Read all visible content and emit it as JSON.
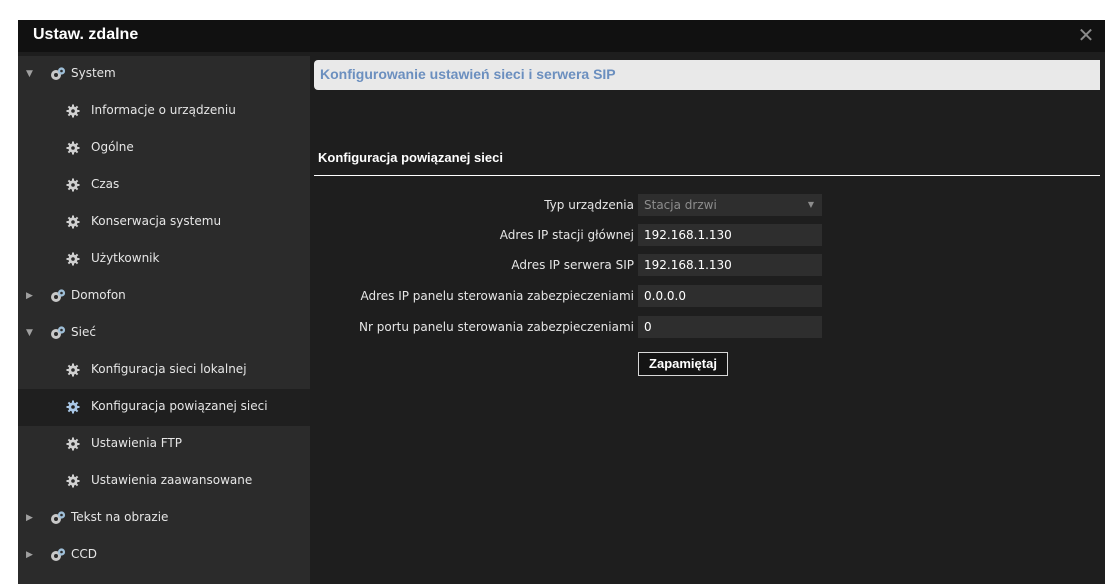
{
  "window": {
    "title": "Ustaw. zdalne",
    "close_glyph": "✕"
  },
  "sidebar": {
    "items": [
      {
        "label": "System",
        "level": "top",
        "expanded": true,
        "icon": "gears-icon"
      },
      {
        "label": "Informacje o urządzeniu",
        "level": "sub",
        "icon": "gear-icon"
      },
      {
        "label": "Ogólne",
        "level": "sub",
        "icon": "gear-icon"
      },
      {
        "label": "Czas",
        "level": "sub",
        "icon": "gear-icon"
      },
      {
        "label": "Konserwacja systemu",
        "level": "sub",
        "icon": "gear-icon"
      },
      {
        "label": "Użytkownik",
        "level": "sub",
        "icon": "gear-icon"
      },
      {
        "label": "Domofon",
        "level": "top",
        "expanded": false,
        "icon": "gears-icon"
      },
      {
        "label": "Sieć",
        "level": "top",
        "expanded": true,
        "icon": "gears-icon"
      },
      {
        "label": "Konfiguracja sieci lokalnej",
        "level": "sub",
        "icon": "gear-icon"
      },
      {
        "label": "Konfiguracja powiązanej sieci",
        "level": "sub",
        "icon": "gear-icon",
        "active": true
      },
      {
        "label": "Ustawienia FTP",
        "level": "sub",
        "icon": "gear-icon"
      },
      {
        "label": "Ustawienia zaawansowane",
        "level": "sub",
        "icon": "gear-icon"
      },
      {
        "label": "Tekst na obrazie",
        "level": "top",
        "expanded": false,
        "icon": "gears-icon"
      },
      {
        "label": "CCD",
        "level": "top",
        "expanded": false,
        "icon": "gears-icon"
      }
    ]
  },
  "main": {
    "heading": "Konfigurowanie ustawień sieci i serwera SIP",
    "section_title": "Konfiguracja powiązanej sieci",
    "fields": {
      "device_type": {
        "label": "Typ urządzenia",
        "value": "Stacja drzwi"
      },
      "main_station_ip": {
        "label": "Adres IP stacji głównej",
        "value": "192.168.1.130"
      },
      "sip_server_ip": {
        "label": "Adres IP serwera SIP",
        "value": "192.168.1.130"
      },
      "security_panel_ip": {
        "label": "Adres IP panelu sterowania zabezpieczeniami",
        "value": "0.0.0.0"
      },
      "security_panel_port": {
        "label": "Nr portu panelu sterowania zabezpieczeniami",
        "value": "0"
      }
    },
    "save_label": "Zapamiętaj"
  },
  "colors": {
    "window_bg": "#1e1e1e",
    "sidebar_bg": "#2b2b2b",
    "heading_text": "#6b8fbf",
    "heading_bg": "#e9e9e9"
  }
}
